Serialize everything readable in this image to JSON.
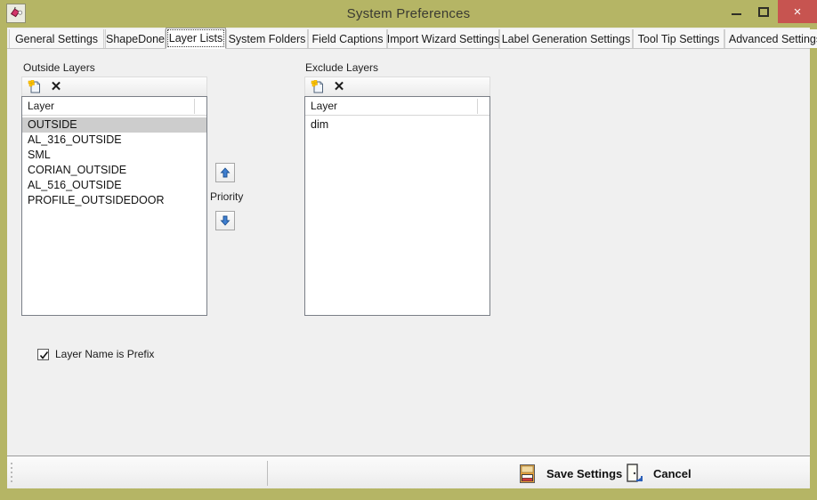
{
  "window": {
    "title": "System Preferences",
    "app_icon": "paint-bucket-icon",
    "controls": {
      "minimize": "–",
      "maximize": "□",
      "close": "×"
    },
    "accent_color": "#b5b565",
    "close_color": "#c75450"
  },
  "tabs": [
    {
      "label": "General Settings",
      "selected": false
    },
    {
      "label": "ShapeDone",
      "selected": false
    },
    {
      "label": "Layer Lists",
      "selected": true
    },
    {
      "label": "System Folders",
      "selected": false
    },
    {
      "label": "Field Captions",
      "selected": false
    },
    {
      "label": "Import Wizard Settings",
      "selected": false
    },
    {
      "label": "Label Generation Settings",
      "selected": false
    },
    {
      "label": "Tool Tip Settings",
      "selected": false
    },
    {
      "label": "Advanced Settings",
      "selected": false
    }
  ],
  "outside_panel": {
    "title": "Outside Layers",
    "toolbar": {
      "new_icon": "new-document-icon",
      "delete_icon": "delete-x-icon"
    },
    "column_header": "Layer",
    "rows": [
      {
        "name": "OUTSIDE",
        "selected": true
      },
      {
        "name": "AL_316_OUTSIDE",
        "selected": false
      },
      {
        "name": "SML",
        "selected": false
      },
      {
        "name": "CORIAN_OUTSIDE",
        "selected": false
      },
      {
        "name": "AL_516_OUTSIDE",
        "selected": false
      },
      {
        "name": "PROFILE_OUTSIDEDOOR",
        "selected": false
      }
    ]
  },
  "exclude_panel": {
    "title": "Exclude Layers",
    "toolbar": {
      "new_icon": "new-document-icon",
      "delete_icon": "delete-x-icon"
    },
    "column_header": "Layer",
    "rows": [
      {
        "name": "dim",
        "selected": false
      }
    ]
  },
  "priority": {
    "label": "Priority",
    "up_icon": "arrow-up-icon",
    "down_icon": "arrow-down-icon"
  },
  "options": {
    "prefix_checkbox": {
      "label": "Layer Name is Prefix",
      "checked": true
    }
  },
  "bottom_bar": {
    "save": {
      "label": "Save Settings",
      "icon": "floppy-disk-icon"
    },
    "cancel": {
      "label": "Cancel",
      "icon": "exit-door-icon"
    }
  }
}
